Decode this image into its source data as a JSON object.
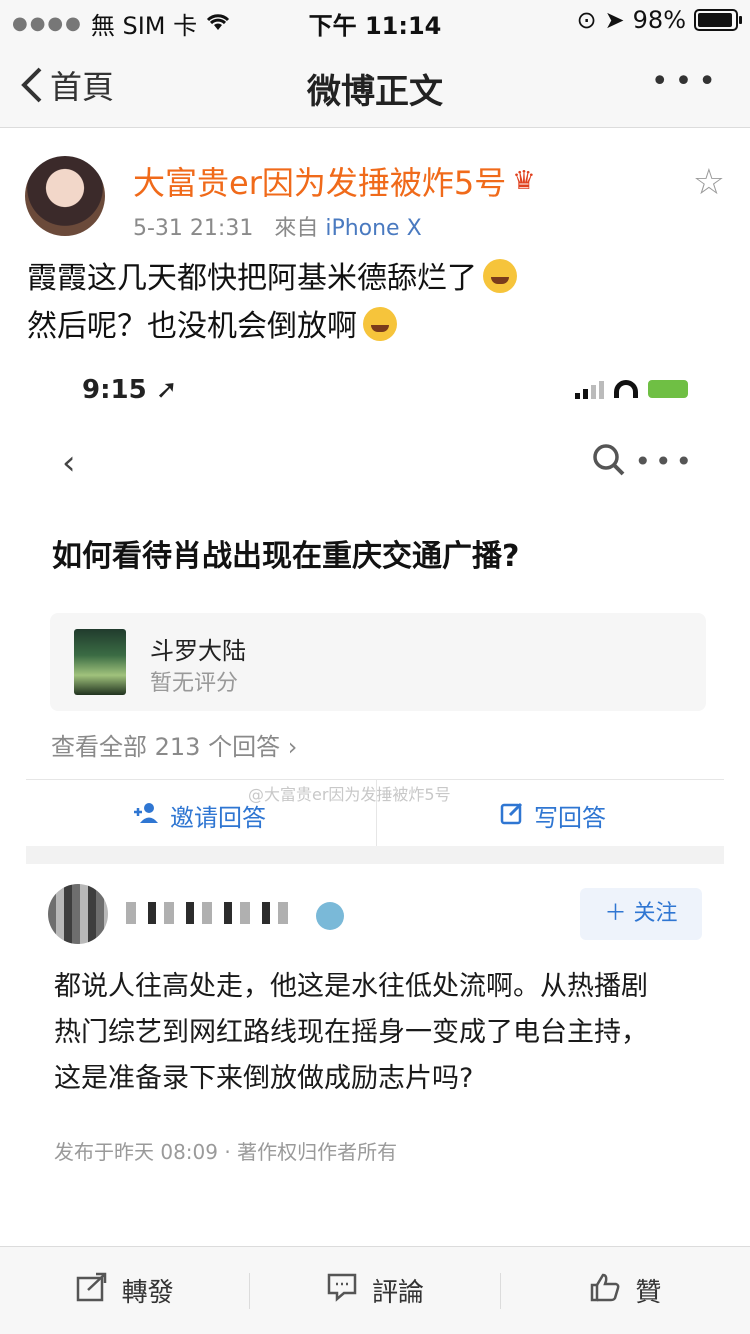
{
  "status_bar": {
    "carrier": "無 SIM 卡",
    "time": "下午 11:14",
    "battery": "98%"
  },
  "nav": {
    "back_label": "首頁",
    "title": "微博正文"
  },
  "post": {
    "username": "大富贵er因为发捶被炸5号",
    "timestamp": "5-31 21:31",
    "source_prefix": "來自",
    "device": "iPhone X",
    "text_line1": "霞霞这几天都快把阿基米德舔烂了",
    "text_line2": "然后呢？也没机会倒放啊"
  },
  "embedded": {
    "time": "9:15",
    "question": "如何看待肖战出现在重庆交通广播?",
    "card": {
      "name": "斗罗大陆",
      "rating": "暂无评分"
    },
    "view_all": "查看全部 213 个回答",
    "invite_label": "邀请回答",
    "write_label": "写回答",
    "watermark": "@大富贵er因为发捶被炸5号",
    "follow_label": "关注",
    "answer_line1": "都说人往高处走，他这是水往低处流啊。从热播剧",
    "answer_line2": "热门综艺到网红路线现在摇身一变成了电台主持，",
    "answer_line3": "这是准备录下来倒放做成励志片吗?",
    "answer_meta": "发布于昨天 08:09 · 著作权归作者所有"
  },
  "toolbar": {
    "repost": "轉發",
    "comment": "評論",
    "like": "贊"
  }
}
